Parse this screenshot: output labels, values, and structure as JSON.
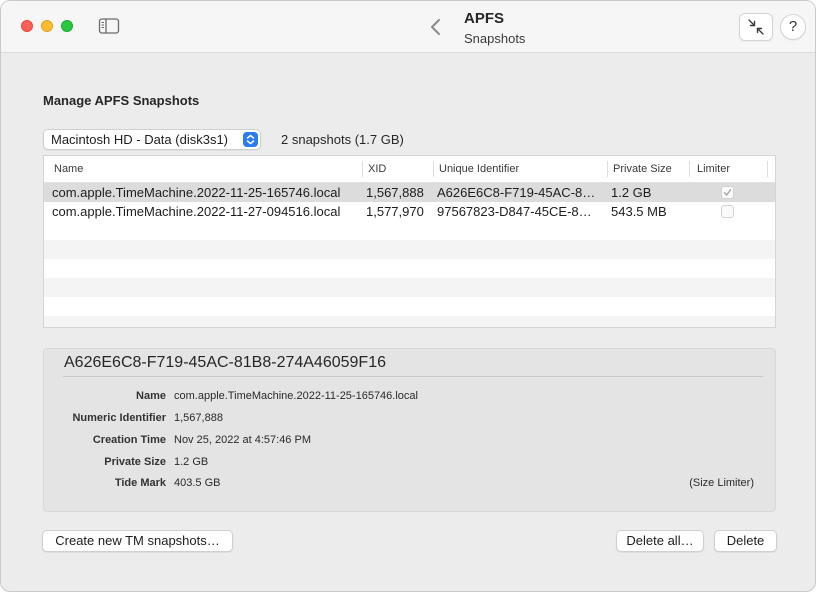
{
  "window": {
    "title": "APFS",
    "subtitle": "Snapshots",
    "help_label": "?"
  },
  "icons": {
    "sidebar": "sidebar-toggle-icon",
    "back": "chevron-left-icon",
    "collapse": "arrows-collapse-icon",
    "select": "up-down-chevron-icon",
    "check": "checkmark-icon"
  },
  "colors": {
    "close": "#ff5f57",
    "minimize": "#febc2e",
    "maximize": "#28c840",
    "accent": "#2b7bf4",
    "selected_row": "#dcdcdc"
  },
  "main": {
    "section_title": "Manage APFS Snapshots",
    "disk_select": {
      "value": "Macintosh HD - Data (disk3s1)"
    },
    "snapshot_count": "2 snapshots (1.7 GB)"
  },
  "table": {
    "columns": [
      "Name",
      "XID",
      "Unique Identifier",
      "Private Size",
      "Limiter"
    ],
    "rows": [
      {
        "name": "com.apple.TimeMachine.2022-11-25-165746.local",
        "xid": "1,567,888",
        "uid": "A626E6C8-F719-45AC-8…",
        "size": "1.2 GB",
        "limiter": true,
        "selected": true
      },
      {
        "name": "com.apple.TimeMachine.2022-11-27-094516.local",
        "xid": "1,577,970",
        "uid": "97567823-D847-45CE-8…",
        "size": "543.5 MB",
        "limiter": false,
        "selected": false
      }
    ]
  },
  "details": {
    "heading": "A626E6C8-F719-45AC-81B8-274A46059F16",
    "fields": [
      {
        "label": "Name",
        "value": "com.apple.TimeMachine.2022-11-25-165746.local"
      },
      {
        "label": "Numeric Identifier",
        "value": "1,567,888"
      },
      {
        "label": "Creation Time",
        "value": "Nov 25, 2022 at 4:57:46 PM"
      },
      {
        "label": "Private Size",
        "value": "1.2 GB"
      },
      {
        "label": "Tide Mark",
        "value": "403.5 GB"
      }
    ],
    "size_limiter": "(Size Limiter)"
  },
  "buttons": {
    "create": "Create new TM snapshots…",
    "delete_all": "Delete all…",
    "delete": "Delete"
  }
}
